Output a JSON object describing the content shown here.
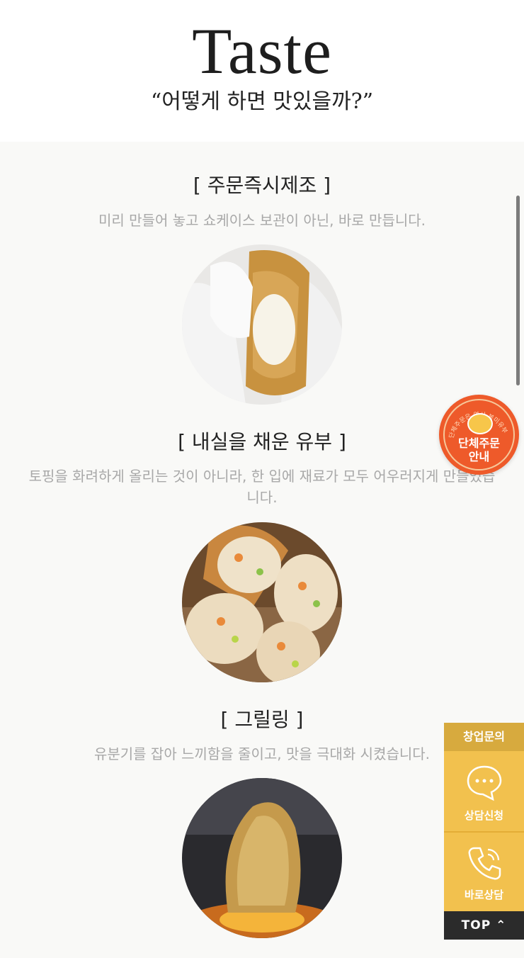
{
  "header": {
    "title": "Taste",
    "subtitle": "“어떻게 하면 맛있을까?”"
  },
  "sections": [
    {
      "title": "[ 주문즉시제조 ]",
      "description": "미리 만들어 놓고 쇼케이스 보관이 아닌, 바로 만듭니다."
    },
    {
      "title": "[ 내실을 채운 유부 ]",
      "description": "토핑을 화려하게 올리는 것이 아니라, 한 입에 재료가 모두 어우러지게 만들었습니다."
    },
    {
      "title": "[ 그릴링 ]",
      "description": "유분기를 잡아 느끼함을 줄이고, 맛을 극대화 시켰습니다."
    }
  ],
  "floating_badge": {
    "arc_text": "단체주문은 역시 봉미유부",
    "line1": "단체주문",
    "line2": "안내"
  },
  "side_panel": {
    "header": "창업문의",
    "consult_label": "상담신청",
    "call_label": "바로상담",
    "top_label": "TOP ⌃"
  },
  "colors": {
    "accent": "#f2c14e",
    "accent_dark": "#d7aa3e",
    "badge": "#ee5a2a",
    "top_button": "#2b2b2b"
  },
  "icons": [
    "chat-bubble-icon",
    "phone-icon",
    "chevron-up-icon",
    "mascot-icon"
  ]
}
